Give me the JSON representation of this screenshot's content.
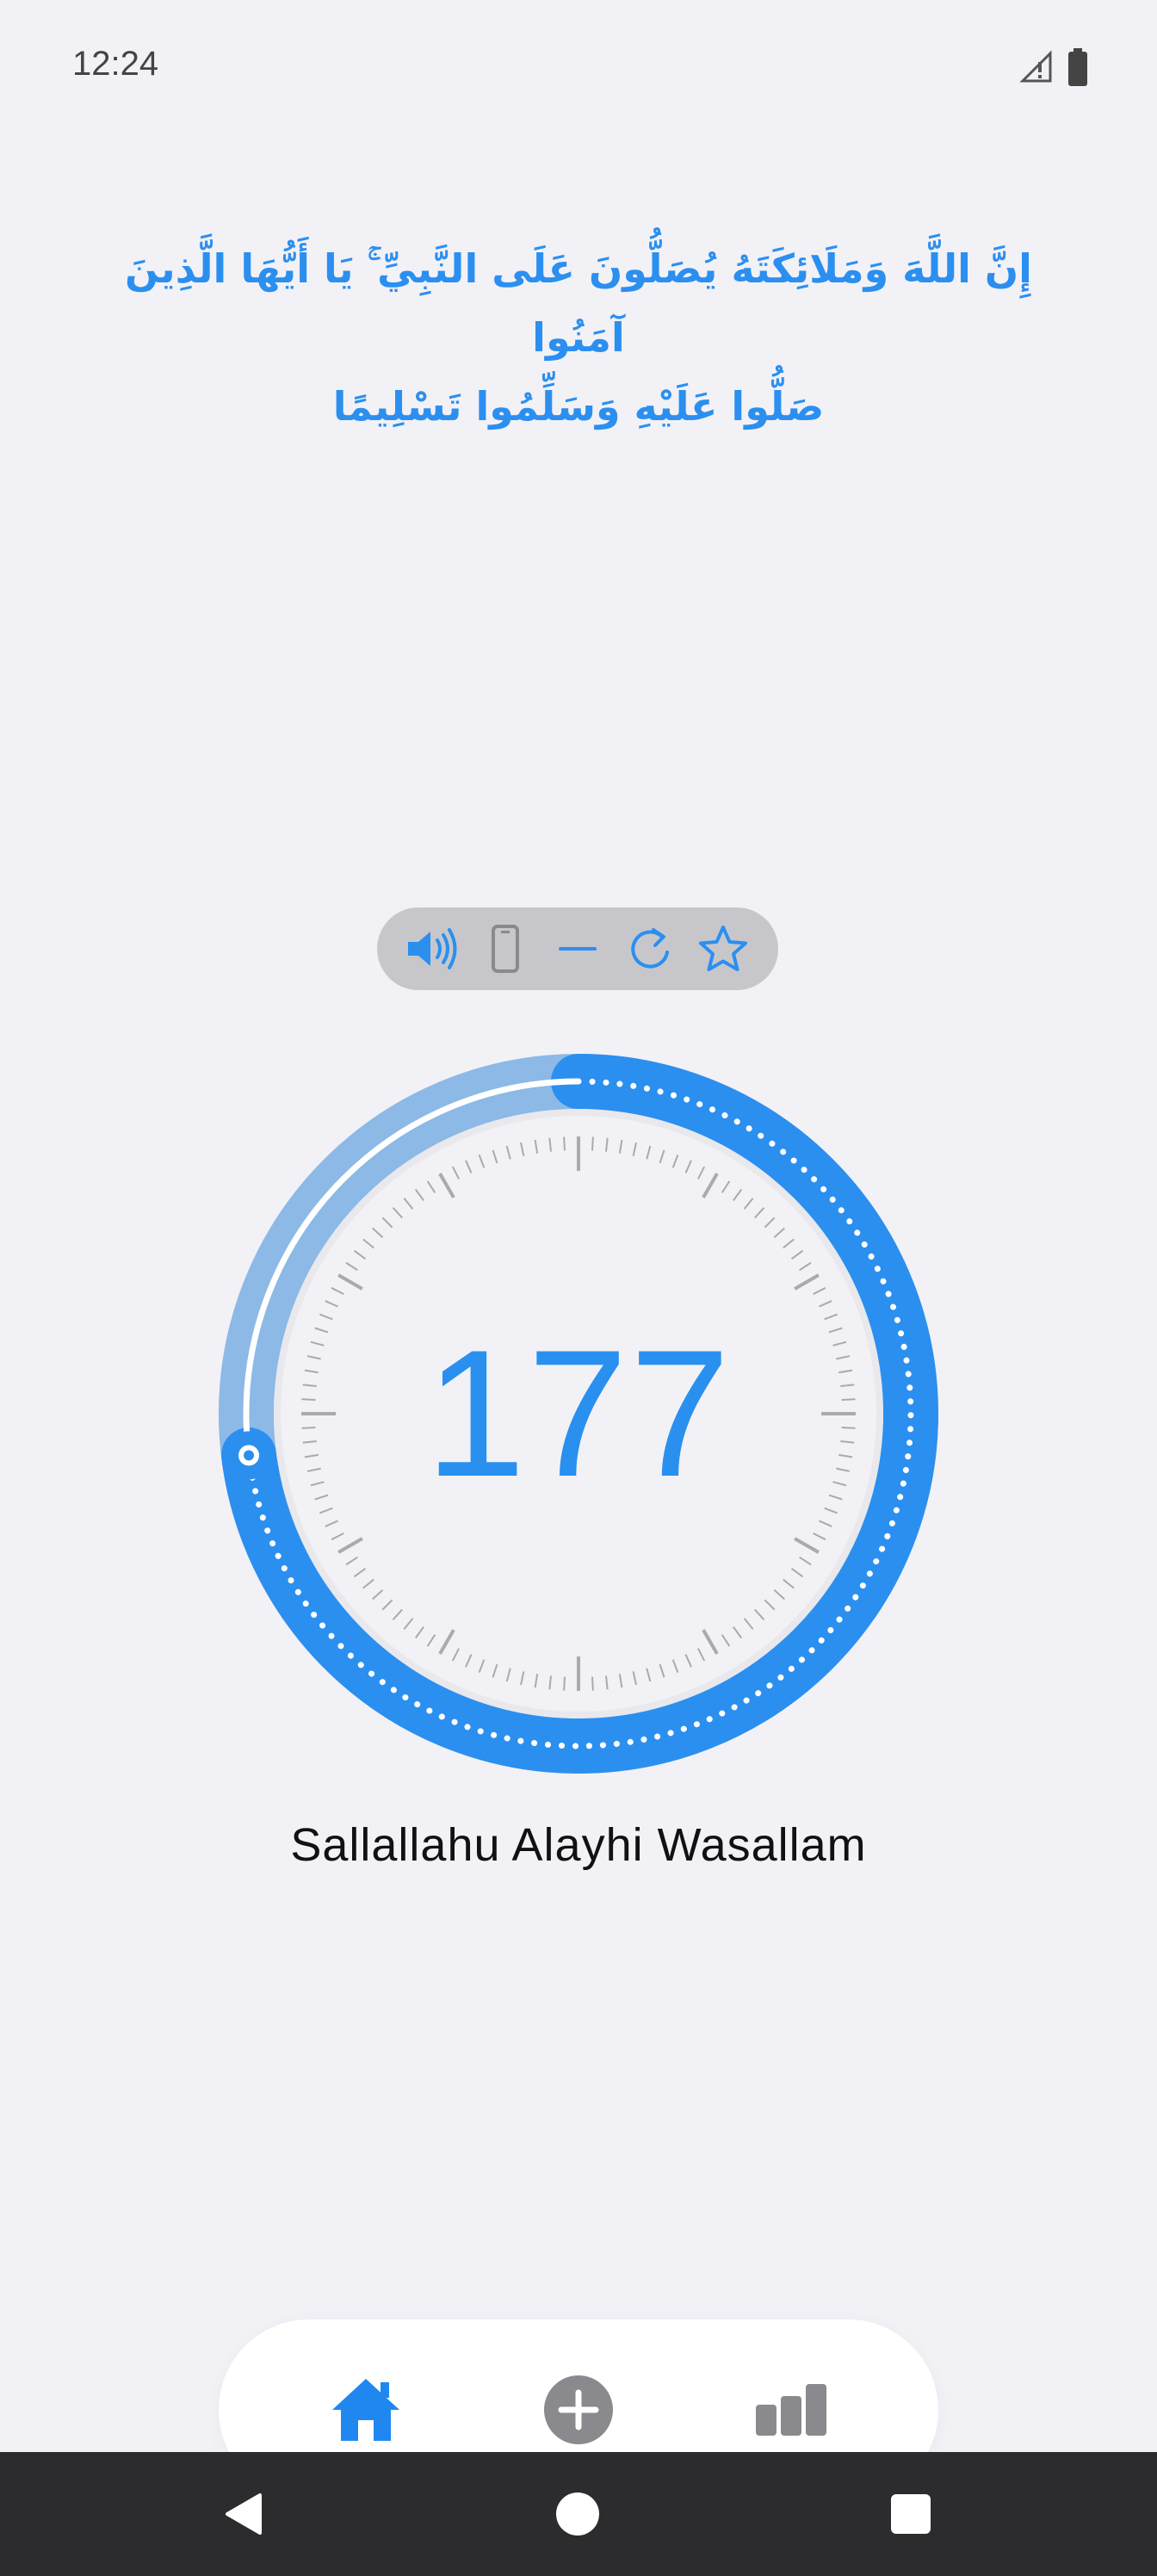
{
  "status_bar": {
    "time": "12:24",
    "icons": [
      "signal-icon",
      "battery-icon"
    ]
  },
  "verse": {
    "line1": "إِنَّ اللَّهَ وَمَلَائِكَتَهُ يُصَلُّونَ عَلَى النَّبِيِّ ۚ يَا أَيُّهَا الَّذِينَ آمَنُوا",
    "line2": "صَلُّوا عَلَيْهِ وَسَلِّمُوا تَسْلِيمًا"
  },
  "toolbar": {
    "items": [
      "speaker-icon",
      "phone-vibrate-icon",
      "minus-icon",
      "reset-icon",
      "star-icon"
    ]
  },
  "counter": {
    "value": "177",
    "progress": 0.73
  },
  "dhikr": {
    "name": "Sallallahu Alayhi Wasallam"
  },
  "bottom_nav": {
    "items": [
      "home-icon",
      "add-icon",
      "stats-icon"
    ],
    "active": "home-icon"
  },
  "system_nav": {
    "items": [
      "back",
      "home",
      "recents"
    ]
  },
  "colors": {
    "accent": "#2b8ff0",
    "accent_light": "#8cb9e6",
    "background": "#f2f1f6",
    "tick": "#aaaaaa"
  }
}
